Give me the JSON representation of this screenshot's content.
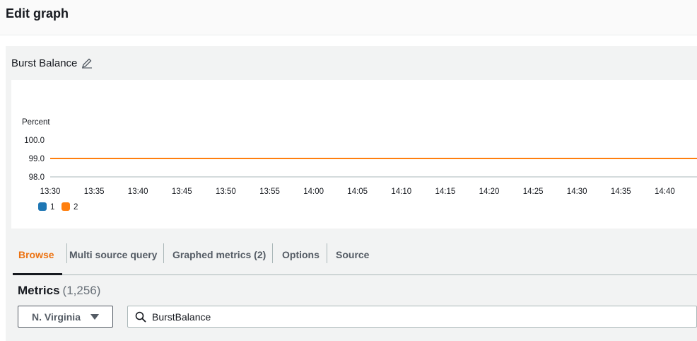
{
  "page": {
    "title": "Edit graph"
  },
  "graph": {
    "title": "Burst Balance",
    "edit_icon": "pencil-icon"
  },
  "chart_data": {
    "type": "line",
    "ylabel": "Percent",
    "yticks": [
      "100.0",
      "99.0",
      "98.0"
    ],
    "ylim": [
      98,
      100
    ],
    "x": [
      "13:30",
      "13:35",
      "13:40",
      "13:45",
      "13:50",
      "13:55",
      "14:00",
      "14:05",
      "14:10",
      "14:15",
      "14:20",
      "14:25",
      "14:30",
      "14:35",
      "14:40"
    ],
    "series": [
      {
        "name": "1",
        "color": "#1f77b4",
        "values": [
          99,
          99,
          99,
          99,
          99,
          99,
          99,
          99,
          99,
          99,
          99,
          99,
          99,
          99,
          99
        ]
      },
      {
        "name": "2",
        "color": "#ff7f0e",
        "values": [
          99,
          99,
          99,
          99,
          99,
          99,
          99,
          99,
          99,
          99,
          99,
          99,
          99,
          99,
          99
        ]
      }
    ],
    "legend": "bottom-left"
  },
  "tabs": [
    {
      "label": "Browse",
      "active": true
    },
    {
      "label": "Multi source query",
      "active": false
    },
    {
      "label": "Graphed metrics (2)",
      "active": false
    },
    {
      "label": "Options",
      "active": false
    },
    {
      "label": "Source",
      "active": false
    }
  ],
  "metrics": {
    "title": "Metrics",
    "count": "(1,256)"
  },
  "region": {
    "label": "N. Virginia"
  },
  "search": {
    "value": "BurstBalance",
    "icon": "search-icon"
  },
  "colors": {
    "accent": "#ec7211",
    "series1": "#1f77b4",
    "series2": "#ff7f0e"
  }
}
